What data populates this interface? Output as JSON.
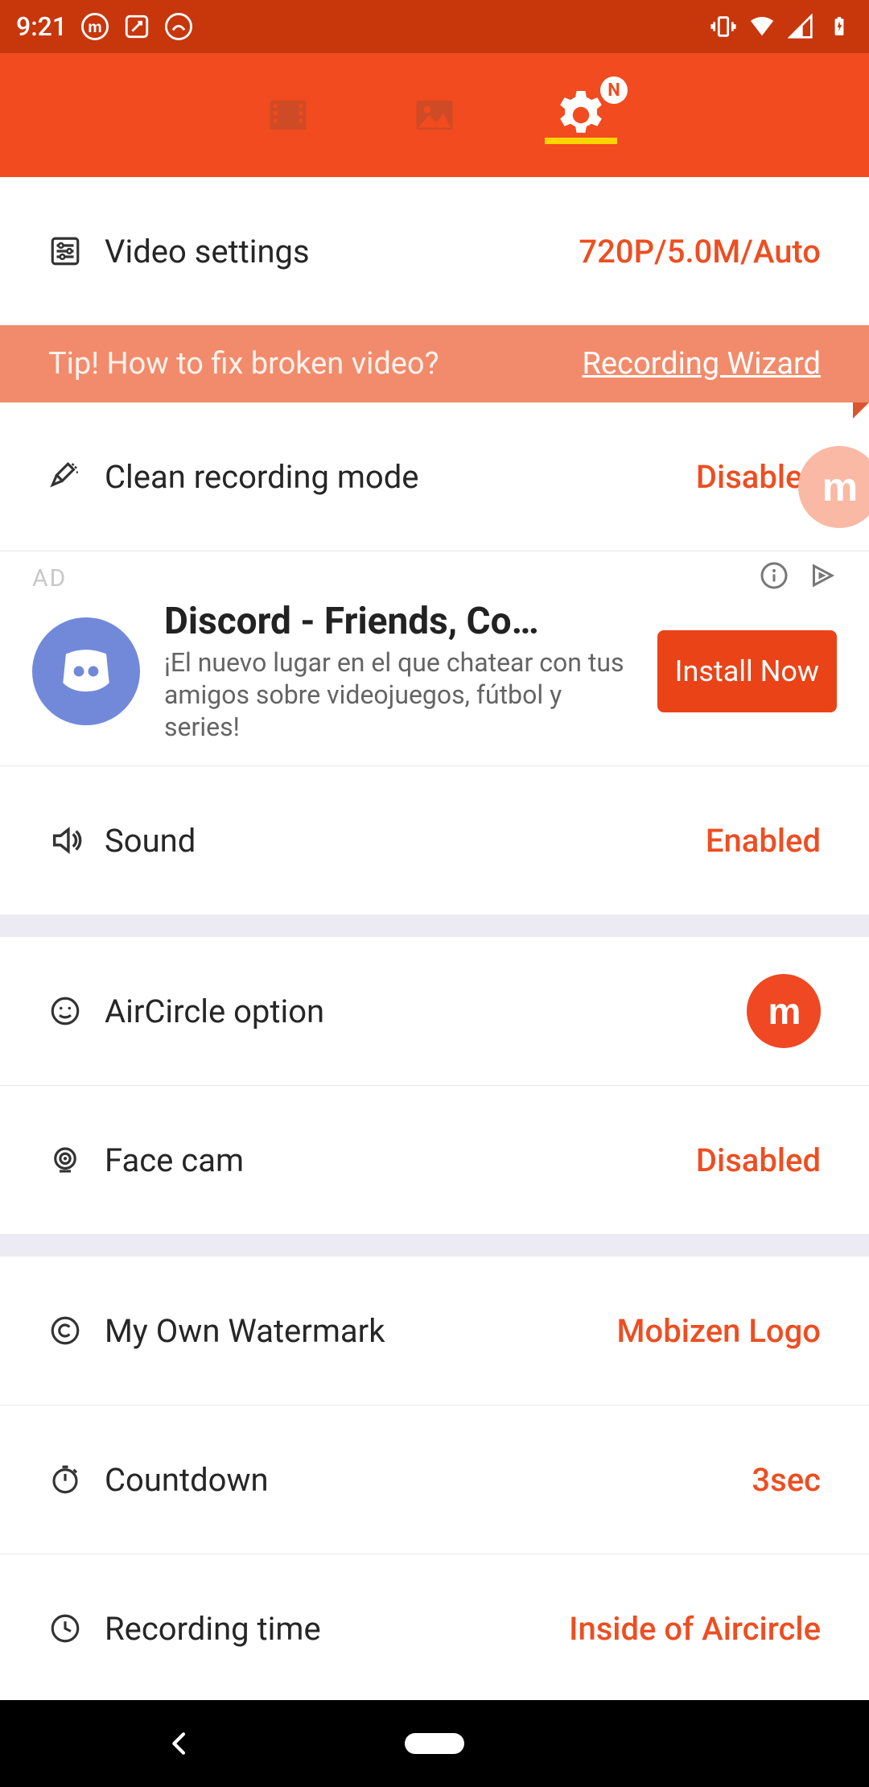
{
  "status_bar": {
    "time": "9:21"
  },
  "tabs": {
    "badge_letter": "N"
  },
  "settings": {
    "video": {
      "label": "Video settings",
      "value": "720P/5.0M/Auto"
    },
    "tip": {
      "text": "Tip! How to fix broken video?",
      "link": "Recording Wizard"
    },
    "clean_mode": {
      "label": "Clean recording mode",
      "value": "Disabled"
    },
    "sound": {
      "label": "Sound",
      "value": "Enabled"
    },
    "aircircle": {
      "label": "AirCircle option"
    },
    "facecam": {
      "label": "Face cam",
      "value": "Disabled"
    },
    "watermark": {
      "label": "My Own Watermark",
      "value": "Mobizen Logo"
    },
    "countdown": {
      "label": "Countdown",
      "value": "3sec"
    },
    "rec_time": {
      "label": "Recording time",
      "value": "Inside of Aircircle"
    }
  },
  "ad": {
    "tag": "AD",
    "title": "Discord - Friends, Co…",
    "desc": "¡El nuevo lugar en el que chatear con tus amigos sobre videojuegos, fútbol y series!",
    "button": "Install Now"
  },
  "logo_letter": "m"
}
